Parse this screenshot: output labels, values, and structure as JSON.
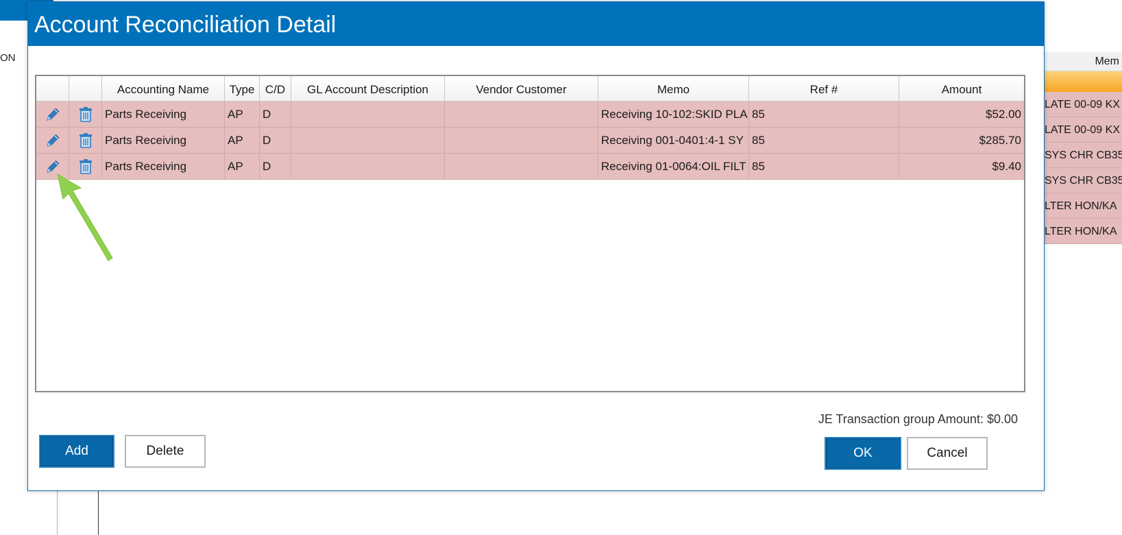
{
  "background": {
    "left_text": "ON",
    "right_header": "Mem",
    "right_rows": [
      "LATE 00-09 KX",
      "LATE 00-09 KX",
      "SYS CHR CB35",
      "SYS CHR CB35",
      "LTER  HON/KA",
      "LTER  HON/KA"
    ]
  },
  "dialog": {
    "title": "Account Reconciliation Detail",
    "columns": [
      "",
      "",
      "Accounting Name",
      "Type",
      "C/D",
      "GL Account Description",
      "Vendor Customer",
      "Memo",
      "Ref #",
      "Amount"
    ],
    "rows": [
      {
        "accounting_name": "Parts Receiving",
        "type": "AP",
        "cd": "D",
        "gl_description": "",
        "vendor_customer": "",
        "memo": "Receiving 10-102:SKID PLA",
        "ref": "85",
        "amount": "$52.00"
      },
      {
        "accounting_name": "Parts Receiving",
        "type": "AP",
        "cd": "D",
        "gl_description": "",
        "vendor_customer": "",
        "memo": "Receiving 001-0401:4-1 SY",
        "ref": "85",
        "amount": "$285.70"
      },
      {
        "accounting_name": "Parts Receiving",
        "type": "AP",
        "cd": "D",
        "gl_description": "",
        "vendor_customer": "",
        "memo": "Receiving 01-0064:OIL FILT",
        "ref": "85",
        "amount": "$9.40"
      }
    ],
    "je_label": "JE Transaction group Amount: $0.00",
    "buttons": {
      "add": "Add",
      "delete": "Delete",
      "ok": "OK",
      "cancel": "Cancel"
    }
  },
  "icons": {
    "edit": "pencil-icon",
    "delete": "trash-icon",
    "annotation": "green-arrow-icon"
  },
  "colors": {
    "title_bar": "#0072bb",
    "row_highlight": "#e6bebe",
    "primary_button": "#0868a8",
    "arrow": "#8fd14f"
  }
}
